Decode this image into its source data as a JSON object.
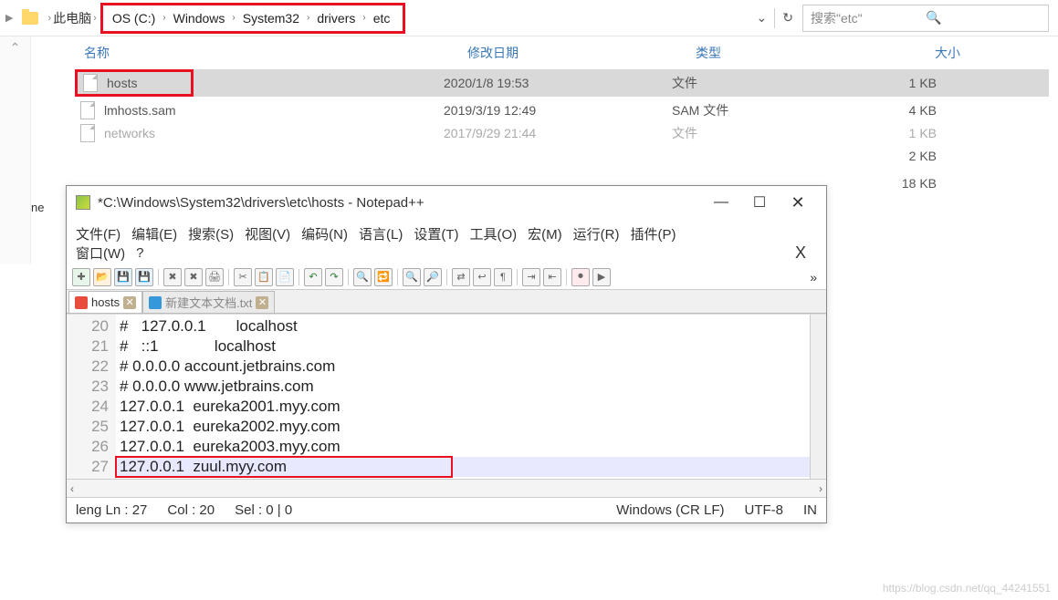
{
  "explorer": {
    "root_label": "此电脑",
    "breadcrumb": [
      "OS (C:)",
      "Windows",
      "System32",
      "drivers",
      "etc"
    ],
    "refresh_chev": "⌄",
    "search_placeholder": "搜索\"etc\"",
    "columns": {
      "name": "名称",
      "date": "修改日期",
      "type": "类型",
      "size": "大小"
    },
    "rows": [
      {
        "name": "hosts",
        "date": "2020/1/8 19:53",
        "type": "文件",
        "size": "1 KB",
        "selected": true,
        "boxed": true
      },
      {
        "name": "lmhosts.sam",
        "date": "2019/3/19 12:49",
        "type": "SAM 文件",
        "size": "4 KB"
      },
      {
        "name": "networks",
        "date": "2017/9/29 21:44",
        "type": "文件",
        "size": "1 KB",
        "partial": true
      },
      {
        "name": "",
        "date": "",
        "type": "",
        "size": "2 KB"
      },
      {
        "name": "",
        "date": "",
        "type": "",
        "size": "18 KB"
      }
    ],
    "left_fragment": "ne"
  },
  "npp": {
    "title": "*C:\\Windows\\System32\\drivers\\etc\\hosts - Notepad++",
    "menu": [
      "文件(F)",
      "编辑(E)",
      "搜索(S)",
      "视图(V)",
      "编码(N)",
      "语言(L)",
      "设置(T)",
      "工具(O)",
      "宏(M)",
      "运行(R)",
      "插件(P)",
      "窗口(W)",
      "?"
    ],
    "tabs": [
      {
        "label": "hosts",
        "active": true,
        "dirty": true
      },
      {
        "label": "新建文本文档.txt",
        "active": false,
        "dirty": false
      }
    ],
    "gutter": [
      "20",
      "21",
      "22",
      "23",
      "24",
      "25",
      "26",
      "27"
    ],
    "lines": [
      "#   127.0.0.1       localhost",
      "#   ::1             localhost",
      "# 0.0.0.0 account.jetbrains.com",
      "# 0.0.0.0 www.jetbrains.com",
      "127.0.0.1  eureka2001.myy.com",
      "127.0.0.1  eureka2002.myy.com",
      "127.0.0.1  eureka2003.myy.com",
      "127.0.0.1  zuul.myy.com"
    ],
    "status": {
      "length": "leng Ln : 27",
      "col": "Col : 20",
      "sel": "Sel : 0 | 0",
      "eol": "Windows (CR LF)",
      "enc": "UTF-8",
      "ins": "IN"
    }
  },
  "watermark": "https://blog.csdn.net/qq_44241551"
}
